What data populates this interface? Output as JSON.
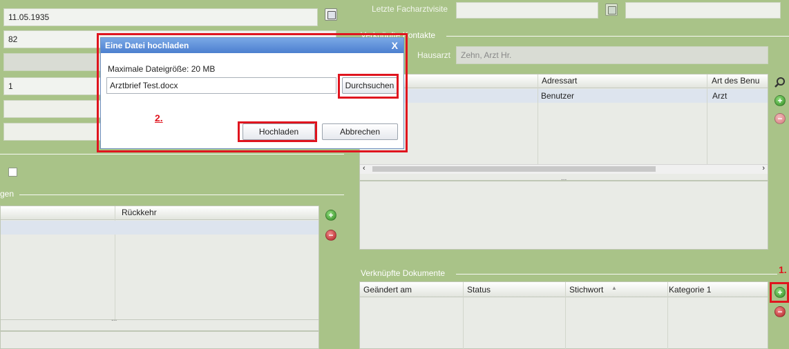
{
  "left": {
    "birthdate_value": "11.05.1935",
    "age_value": "82",
    "number_value": "1",
    "section_label": "gen",
    "table_col_rueckkehr": "Rückkehr",
    "splitter": "..."
  },
  "right": {
    "last_visit_label": "Letzte Facharztvisite",
    "contacts_group_label": "Verknüpfte Kontakte",
    "hausarzt_label": "Hausarzt",
    "hausarzt_value": "Zehn, Arzt Hr.",
    "contacts_headers": [
      "Adressart",
      "Art des Benu"
    ],
    "contacts_row": [
      "Benutzer",
      "Arzt"
    ],
    "splitter": "...",
    "docs_group_label": "Verknüpfte Dokumente",
    "docs_headers": [
      "Geändert am",
      "Status",
      "Stichwort",
      "Kategorie 1"
    ],
    "sort_icon": "sort-up-icon"
  },
  "dialog": {
    "title": "Eine Datei hochladen",
    "close": "X",
    "max_size_label": "Maximale Dateigröße: 20 MB",
    "file_value": "Arztbrief Test.docx",
    "browse_label": "Durchsuchen",
    "upload_label": "Hochladen",
    "cancel_label": "Abbrechen"
  },
  "annotations": {
    "step1": "1.",
    "step2": "2.",
    "highlight_color": "#e0141e"
  },
  "colors": {
    "app_background": "#a9c388",
    "dialog_title": "#4c7fcf"
  }
}
